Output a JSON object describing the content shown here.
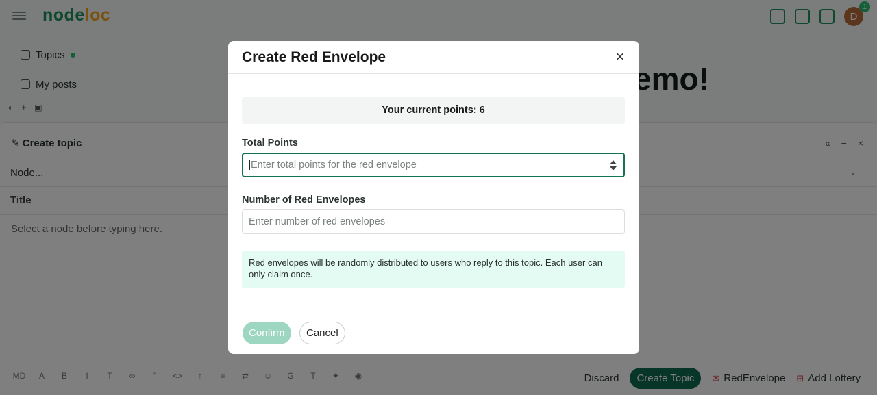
{
  "header": {
    "logo_main": "node",
    "logo_accent": "loc",
    "avatar_letter": "D",
    "notification_count": "1"
  },
  "sidebar": {
    "items": [
      {
        "label": "Topics"
      },
      {
        "label": "My posts"
      }
    ]
  },
  "hero": {
    "text": "emo!"
  },
  "composer": {
    "header_label": "Create topic",
    "node_placeholder": "Node...",
    "title_placeholder": "Title",
    "editor_placeholder": "Select a node before typing here.",
    "discard_label": "Discard",
    "create_topic_label": "Create Topic",
    "red_envelope_label": "RedEnvelope",
    "add_lottery_label": "Add Lottery"
  },
  "modal": {
    "title": "Create Red Envelope",
    "close_symbol": "×",
    "current_points_text": "Your current points: 6",
    "total_points_label": "Total Points",
    "total_points_placeholder": "Enter total points for the red envelope",
    "total_points_value": "",
    "count_label": "Number of Red Envelopes",
    "count_placeholder": "Enter number of red envelopes",
    "count_value": "",
    "info_text": "Red envelopes will be randomly distributed to users who reply to this topic. Each user can only claim once.",
    "confirm_label": "Confirm",
    "cancel_label": "Cancel"
  },
  "colors": {
    "brand_green": "#0f6b4e",
    "confirm_disabled": "#9dd6c1",
    "info_bg": "#e3fbf2",
    "focus_border": "#147257"
  }
}
